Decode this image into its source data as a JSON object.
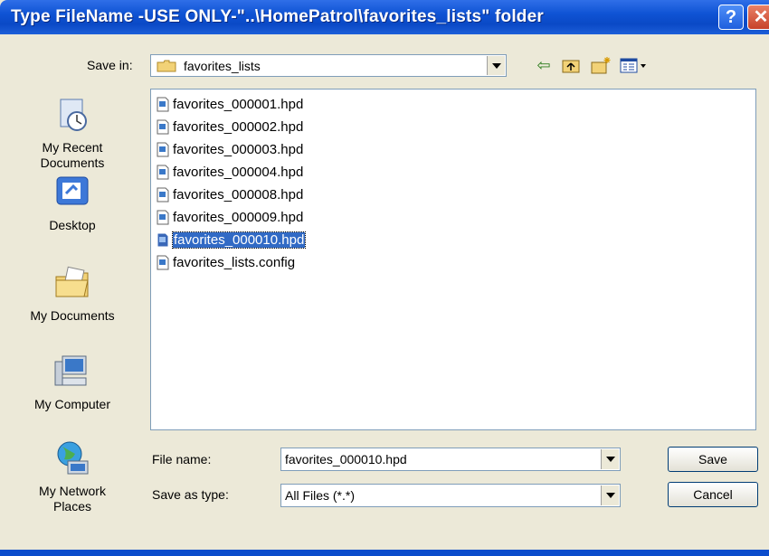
{
  "window": {
    "title": "Type FileName -USE ONLY-\"..\\HomePatrol\\favorites_lists\" folder"
  },
  "savein": {
    "label": "Save in:",
    "value": "favorites_lists"
  },
  "toolbar": {
    "icons": [
      "back-arrow-icon",
      "up-folder-icon",
      "new-folder-icon",
      "view-menu-icon"
    ]
  },
  "places": [
    {
      "label": "My Recent\nDocuments",
      "icon": "recent-documents-icon"
    },
    {
      "label": "Desktop",
      "icon": "desktop-icon"
    },
    {
      "label": "My Documents",
      "icon": "my-documents-icon"
    },
    {
      "label": "My Computer",
      "icon": "my-computer-icon"
    },
    {
      "label": "My Network\nPlaces",
      "icon": "network-places-icon"
    }
  ],
  "files": [
    "favorites_000001.hpd",
    "favorites_000002.hpd",
    "favorites_000003.hpd",
    "favorites_000004.hpd",
    "favorites_000008.hpd",
    "favorites_000009.hpd",
    "favorites_000010.hpd",
    "favorites_lists.config"
  ],
  "selected_file": "favorites_000010.hpd",
  "form": {
    "filename_label": "File name:",
    "filename_value": "favorites_000010.hpd",
    "filetype_label": "Save as type:",
    "filetype_value": "All Files (*.*)"
  },
  "buttons": {
    "save": "Save",
    "cancel": "Cancel"
  },
  "colors": {
    "title_blue": "#0a49c6",
    "selection": "#316ac5",
    "dialog_bg": "#ece9d8"
  }
}
